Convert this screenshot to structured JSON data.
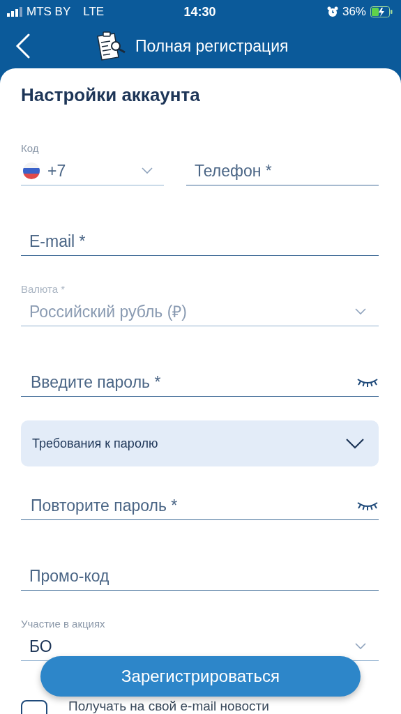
{
  "status_bar": {
    "carrier": "MTS BY",
    "network": "LTE",
    "time": "14:30",
    "battery": "36%"
  },
  "header": {
    "title": "Полная регистрация"
  },
  "section_title": "Настройки аккаунта",
  "phone": {
    "code_label": "Код",
    "code": "+7",
    "placeholder": "Телефон *"
  },
  "fields": [
    {
      "kind": "text",
      "placeholder": "E-mail *"
    },
    {
      "kind": "select",
      "label": "Валюта *",
      "value": "Российский рубль (₽)",
      "disabled": true
    },
    {
      "kind": "password",
      "placeholder": "Введите пароль *"
    },
    {
      "kind": "panel",
      "label": "Требования к паролю",
      "expanded": false
    },
    {
      "kind": "password",
      "placeholder": "Повторите пароль *"
    },
    {
      "kind": "text",
      "placeholder": "Промо-код"
    },
    {
      "kind": "select",
      "label": "Участие в акциях",
      "value": "БО",
      "disabled": false
    }
  ],
  "register_button": "Зарегистрироваться",
  "newsletter": {
    "label": "Получать на свой e-mail новости",
    "checked": false
  }
}
